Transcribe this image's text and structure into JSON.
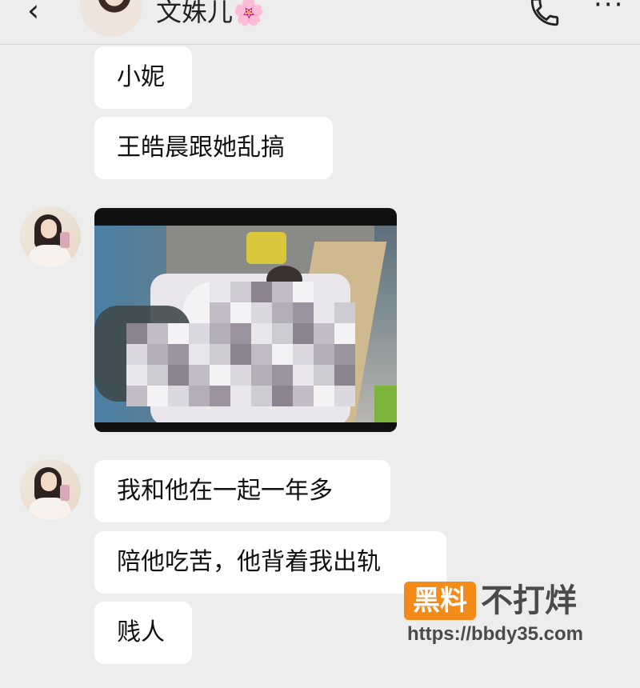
{
  "header": {
    "back_glyph": "‹",
    "contact_name": "文姝儿🌸",
    "more_glyph": "···"
  },
  "messages": [
    {
      "type": "text",
      "text": "小妮"
    },
    {
      "type": "text",
      "text": "王皓晨跟她乱搞"
    },
    {
      "type": "video"
    },
    {
      "type": "text",
      "text": "我和他在一起一年多"
    },
    {
      "type": "text",
      "text": "陪他吃苦，他背着我出轨"
    },
    {
      "type": "text",
      "text": "贱人"
    }
  ],
  "watermark": {
    "badge": "黑料",
    "name": "不打烊",
    "url": "https://bbdy35.com"
  },
  "colors": {
    "background": "#ededed",
    "bubble": "#ffffff",
    "watermark_orange": "#f28b1a"
  }
}
